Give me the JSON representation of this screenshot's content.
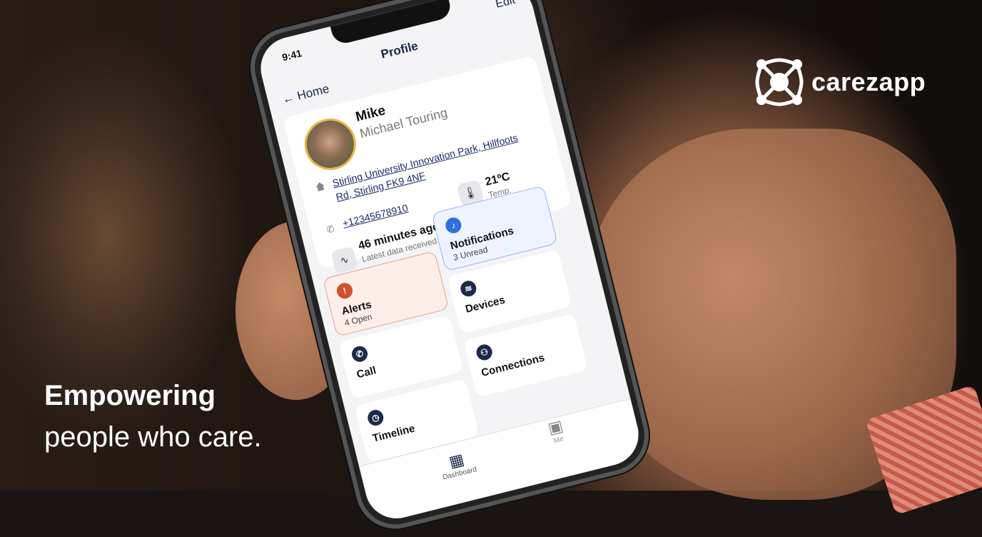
{
  "brand": {
    "name": "carezapp",
    "tagline_bold": "Empowering",
    "tagline": "people who care."
  },
  "status_bar": {
    "time": "9:41"
  },
  "nav": {
    "title": "Profile",
    "back": "← Home",
    "edit": "Edit"
  },
  "profile": {
    "name": "Mike",
    "full_name": "Michael Touring",
    "address": "Stirling University Innovation Park, Hillfoots Rd, Stirling FK9 4NF",
    "phone": "+12345678910",
    "temperature": "21ºC",
    "temperature_label": "Temp.",
    "last_data": "46 minutes ago",
    "last_data_label": "Latest data received"
  },
  "tiles": {
    "notifications": {
      "title": "Notifications",
      "subtitle": "3 Unread"
    },
    "alerts": {
      "title": "Alerts",
      "subtitle": "4 Open"
    },
    "devices": {
      "title": "Devices"
    },
    "call": {
      "title": "Call"
    },
    "connections": {
      "title": "Connections"
    },
    "timeline": {
      "title": "Timeline"
    }
  },
  "tabbar": {
    "dashboard": "Dashboard",
    "me": "Me"
  },
  "colors": {
    "alert": "#d2502d",
    "notification": "#2f6fe0",
    "navy": "#1b2a4a"
  }
}
